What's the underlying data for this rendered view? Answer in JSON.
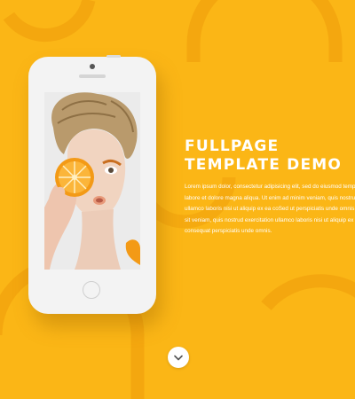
{
  "hero": {
    "title_line1": "FULLPAGE",
    "title_line2": "TEMPLATE DEMO",
    "description": "Lorem ipsum dolor, consectetur adipisicing elit, sed do eiusmod tempor incididunt ut labore et dolore magna aliqua. Ut enim ad minim veniam, quis nostrud exercitation ullamco laboris nisi ut aliquip ex ea coSed ut perspiciatis unde omnis iste natus error sit veniam, quis nostrud exercitation ullamco laboris nisi ut aliquip ex ea commodo consequat perspiciatis unde omnis."
  },
  "phone": {
    "screen_image": "woman-holding-orange-slice-photo"
  },
  "scroll_button": {
    "icon": "chevron-down-icon"
  },
  "colors": {
    "background": "#fbb616",
    "decor_arc": "#f5a812",
    "text": "#ffffff",
    "button": "#ffffff",
    "button_icon": "#555555"
  }
}
